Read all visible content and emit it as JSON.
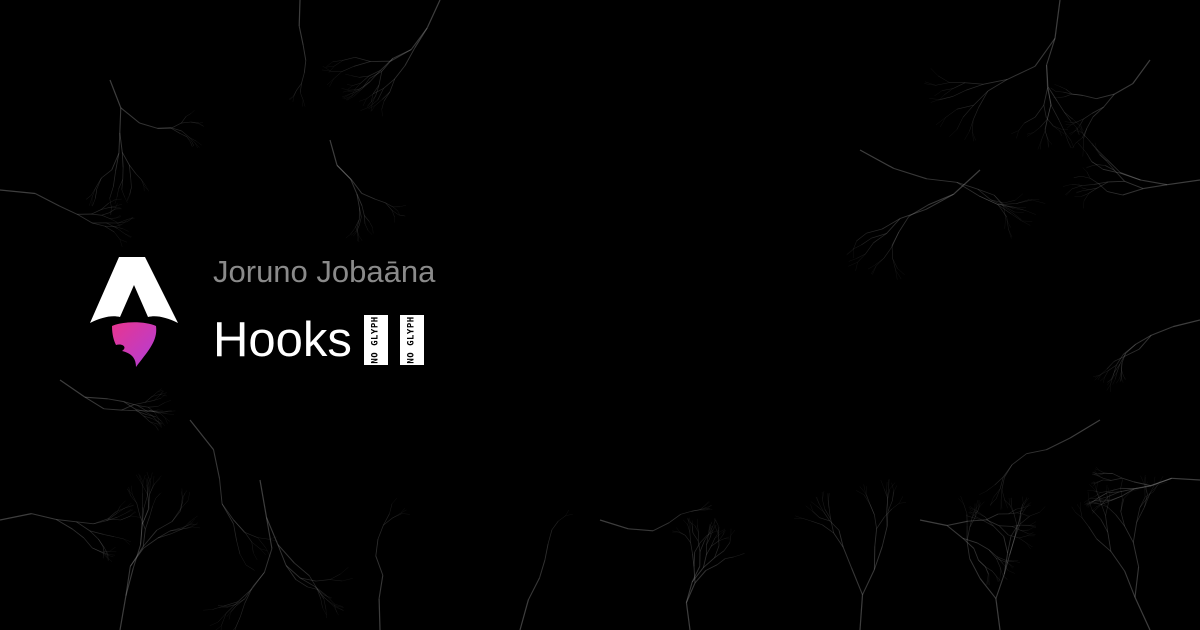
{
  "brand": {
    "logo_icon": "astro-logo-icon",
    "logo_colors": {
      "body": "#ffffff",
      "flame_start": "#e8358f",
      "flame_end": "#b13ed8"
    }
  },
  "header": {
    "subtitle": "Joruno Jobaāna",
    "title": "Hooks",
    "missing_glyphs": [
      "NO GLYPH",
      "NO GLYPH"
    ]
  },
  "colors": {
    "background": "#000000",
    "subtitle": "#8a8a8a",
    "title": "#ffffff",
    "texture": "#9a9a9a"
  }
}
